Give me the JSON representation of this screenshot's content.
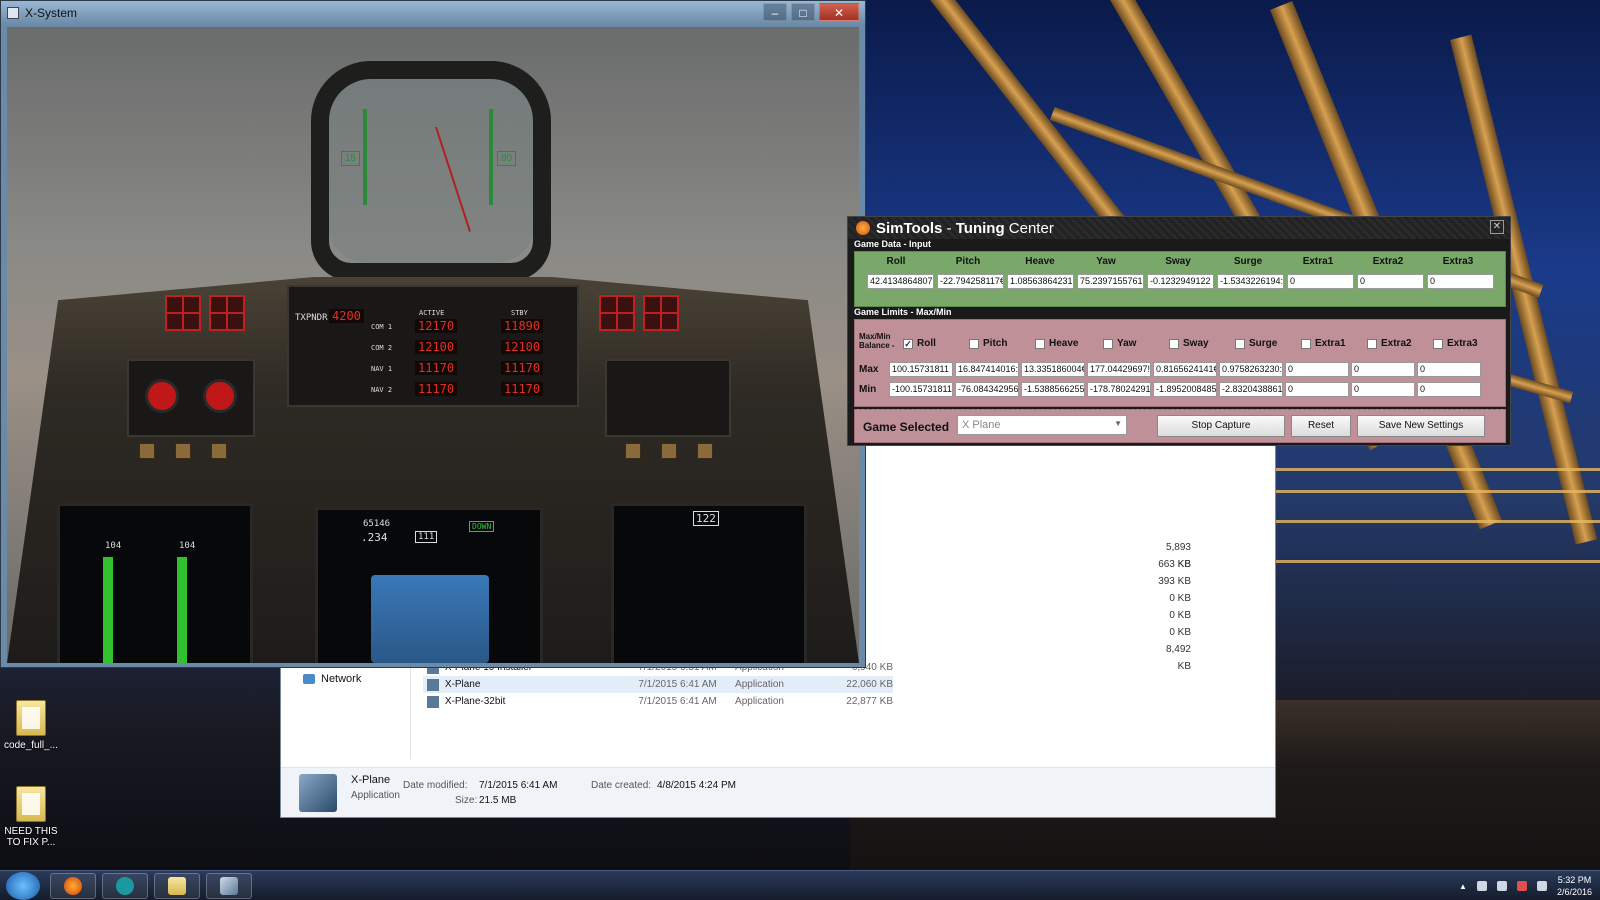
{
  "xsystem": {
    "title": "X-System"
  },
  "hud": {
    "left_value": "15",
    "right_value": "80"
  },
  "cockpit": {
    "txpndr_label": "TXPNDR",
    "txpndr_value": "4200",
    "active_label": "ACTIVE",
    "stby_label": "STBY",
    "rows": [
      {
        "label": "COM 1",
        "active": "12170",
        "stby": "11890"
      },
      {
        "label": "COM 2",
        "active": "12100",
        "stby": "12100"
      },
      {
        "label": "NAV 1",
        "active": "11170",
        "stby": "11170"
      },
      {
        "label": "NAV 2",
        "active": "11170",
        "stby": "11170"
      }
    ],
    "mfd_left_a": "104",
    "mfd_left_b": "104",
    "mfd_center_alt": "65146",
    "mfd_center_vs": ".234",
    "mfd_center_box": "111",
    "mfd_center_gear": "DOWN",
    "mfd_right_heading": "122"
  },
  "explorer": {
    "sizes": [
      "5,893 KB",
      "663 KB",
      "393 KB",
      "0 KB",
      "0 KB",
      "0 KB",
      "8,492 KB"
    ],
    "nav_network": "Network",
    "files": [
      {
        "name": "X-Plane 10 Installer",
        "date": "7/1/2015 6:31 AM",
        "type": "Application",
        "size": "6,940 KB"
      },
      {
        "name": "X-Plane",
        "date": "7/1/2015 6:41 AM",
        "type": "Application",
        "size": "22,060 KB"
      },
      {
        "name": "X-Plane-32bit",
        "date": "7/1/2015 6:41 AM",
        "type": "Application",
        "size": "22,877 KB"
      }
    ],
    "details": {
      "name": "X-Plane",
      "type": "Application",
      "modified_label": "Date modified:",
      "modified_value": "7/1/2015 6:41 AM",
      "created_label": "Date created:",
      "created_value": "4/8/2015 4:24 PM",
      "size_label": "Size:",
      "size_value": "21.5 MB"
    }
  },
  "simtools": {
    "title_a": "SimTools",
    "title_b": " - ",
    "title_c": "Tuning",
    "title_d": " Center",
    "game_data_label": "Game Data - Input",
    "columns": [
      "Roll",
      "Pitch",
      "Heave",
      "Yaw",
      "Sway",
      "Surge",
      "Extra1",
      "Extra2",
      "Extra3"
    ],
    "input_values": [
      "42.4134864807",
      "-22.794258117€",
      "1.08563864231",
      "75.2397155761",
      "-0.1232949122",
      "-1.5343226194:",
      "0",
      "0",
      "0"
    ],
    "game_limits_label": "Game Limits - Max/Min",
    "maxmin_label_1": "Max/Min",
    "maxmin_label_2": "Balance -",
    "checked": [
      true,
      false,
      false,
      false,
      false,
      false,
      false,
      false,
      false
    ],
    "max_label": "Max",
    "min_label": "Min",
    "max_values": [
      "100.15731811",
      "16.847414016:",
      "13.335186004€",
      "177.04429697!",
      "0.8165624141€",
      "0.9758263230:",
      "0",
      "0",
      "0"
    ],
    "min_values": [
      "-100.15731811",
      "-76.084342956",
      "-1.5388566255",
      "-178.78024291",
      "-1.8952008485",
      "-2.8320438861",
      "0",
      "0",
      "0"
    ],
    "game_selected_label": "Game Selected",
    "game_selected_value": "X Plane",
    "stop_capture": "Stop Capture",
    "reset": "Reset",
    "save_new_settings": "Save New Settings"
  },
  "desktop": {
    "icons": [
      {
        "label": "code_full_..."
      },
      {
        "label": "NEED THIS TO FIX P..."
      }
    ]
  },
  "taskbar": {
    "time": "5:32 PM",
    "date": "2/6/2016"
  }
}
